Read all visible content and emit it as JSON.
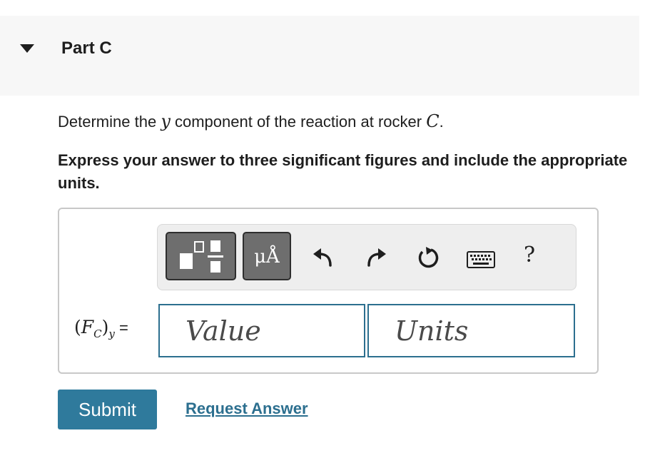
{
  "part": {
    "title": "Part C"
  },
  "question": {
    "prefix": "Determine the",
    "variable": "y",
    "middle": "component of the reaction at rocker",
    "point": "C",
    "suffix": "."
  },
  "instructions": "Express your answer to three significant figures and include the appropriate units.",
  "toolbar": {
    "units_glyph": "μÅ",
    "help_label": "?",
    "icons": [
      "templates-icon",
      "units-icon",
      "undo-icon",
      "redo-icon",
      "reset-icon",
      "keyboard-icon",
      "help-icon"
    ]
  },
  "answer": {
    "label_open": "(",
    "label_var": "F",
    "label_sub": "C",
    "label_close": ")",
    "label_sub2": "y",
    "label_eq": " =",
    "value_placeholder": "Value",
    "units_placeholder": "Units"
  },
  "actions": {
    "submit": "Submit",
    "request_answer": "Request Answer"
  },
  "colors": {
    "accent": "#2f7a9c",
    "link": "#2c6f8f",
    "header_bg": "#f7f7f7"
  }
}
